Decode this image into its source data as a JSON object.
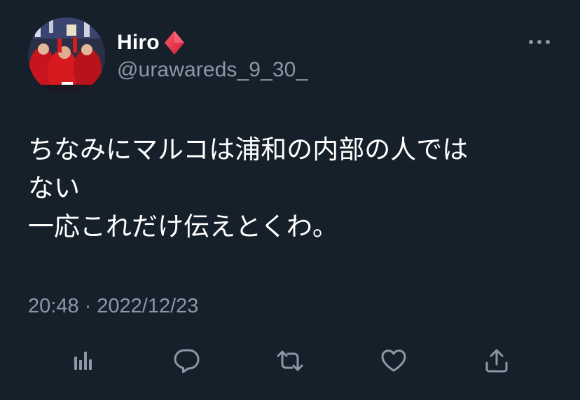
{
  "author": {
    "display_name": "Hiro",
    "badge_icon": "red-diamond-icon",
    "handle": "@urawareds_9_30_"
  },
  "tweet": {
    "lines": [
      "ちなみにマルコは浦和の内部の人では",
      "ない",
      "一応これだけ伝えとくわ。"
    ],
    "time": "20:48",
    "separator": "·",
    "date": "2022/12/23"
  },
  "actions": [
    {
      "icon": "analytics-icon"
    },
    {
      "icon": "reply-icon"
    },
    {
      "icon": "retweet-icon"
    },
    {
      "icon": "like-icon"
    },
    {
      "icon": "share-icon"
    }
  ],
  "colors": {
    "background": "#15202b",
    "text_primary": "#ffffff",
    "text_secondary": "#8b98a5",
    "badge": "#e0245e"
  }
}
